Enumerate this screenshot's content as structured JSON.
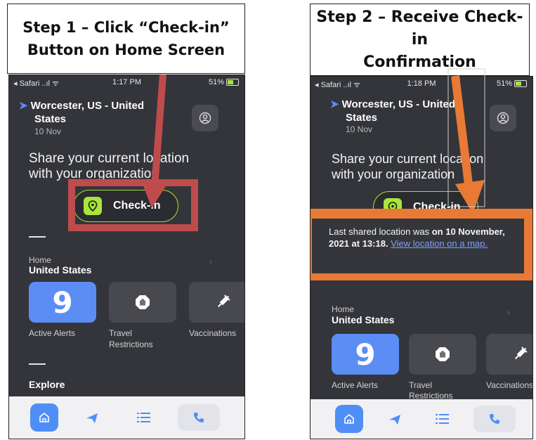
{
  "captions": {
    "step1_line1": "Step 1 – Click “Check-in”",
    "step1_line2": "Button on Home Screen",
    "step2_line1": "Step 2 – Receive Check-in",
    "step2_line2": "Confirmation"
  },
  "screen1": {
    "status_left": "◂ Safari ..ıl ᯤ",
    "time": "1:17 PM",
    "battery": "51%",
    "location_line1": "Worcester, US - United",
    "location_line2": "States",
    "date": "10 Nov",
    "share_line1": "Share your current location",
    "share_line2": "with your organization",
    "checkin_label": "Check-in",
    "home_label": "Home",
    "country": "United States",
    "alerts_count": "9",
    "tiles": [
      "Active Alerts",
      "Travel",
      "Restrictions",
      "Vaccinations"
    ],
    "explore": "Explore"
  },
  "screen2": {
    "status_left": "◂ Safari ..ıl ᯤ",
    "time": "1:18 PM",
    "battery": "51%",
    "location_line1": "Worcester, US - United",
    "location_line2": "States",
    "date": "10 Nov",
    "share_line1": "Share your current location",
    "share_line2": "with your organization",
    "checkin_label": "Check-in",
    "confirm_prefix": "Last shared location was",
    "confirm_bold": "on 10 November, 2021 at 13:18.",
    "confirm_link": "View location on a map.",
    "home_label": "Home",
    "country": "United States",
    "alerts_count": "9",
    "tiles": [
      "Active Alerts",
      "Travel",
      "Restrictions",
      "Vaccinations"
    ]
  },
  "colors": {
    "accent_green": "#a8e63a",
    "alert_blue": "#5b8df5",
    "annotation_red": "#bf4c4c",
    "annotation_orange": "#e87a35"
  },
  "icons": [
    "location-arrow-icon",
    "profile-icon",
    "map-pin-icon",
    "hand-stop-icon",
    "syringe-icon",
    "home-icon",
    "plane-icon",
    "list-icon",
    "phone-icon"
  ]
}
